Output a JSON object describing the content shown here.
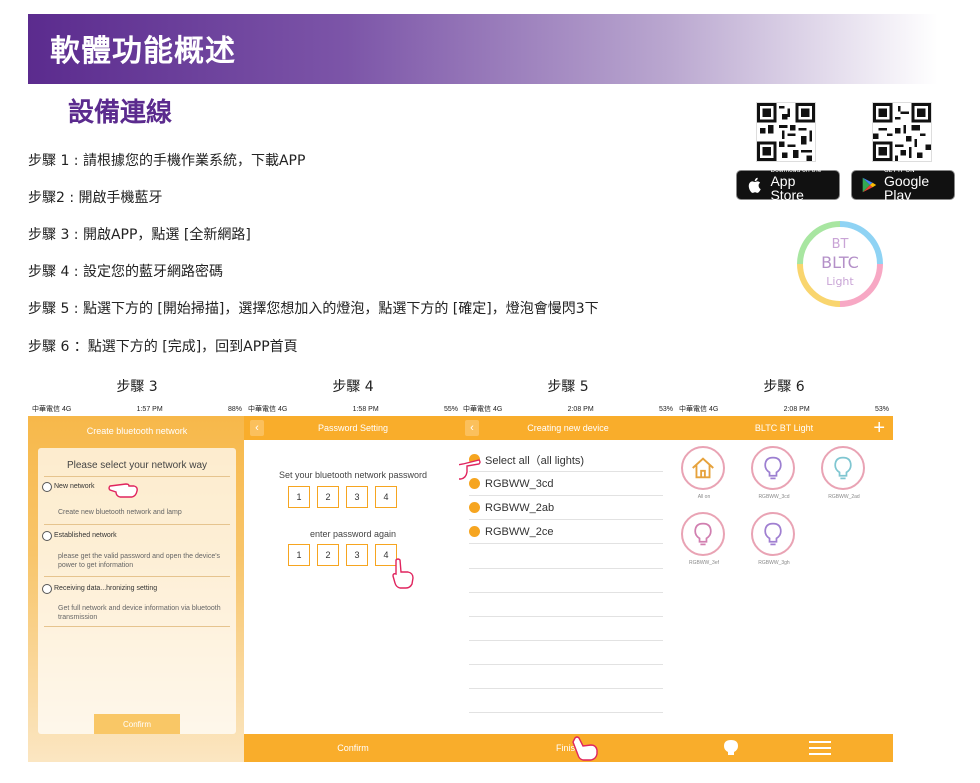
{
  "banner": {
    "title": "軟體功能概述"
  },
  "section": {
    "title": "設備連線"
  },
  "steps": [
    "步驟 1 : 請根據您的手機作業系統，下載APP",
    "步驟2 : 開啟手機藍牙",
    "步驟 3 : 開啟APP，點選 [全新網路]",
    "步驟 4 : 設定您的藍牙網路密碼",
    "步驟 5 : 點選下方的 [開始掃描]，選擇您想加入的燈泡，點選下方的 [確定]，燈泡會慢閃3下",
    "步驟 6 ：點選下方的 [完成]，回到APP首頁"
  ],
  "stores": {
    "appstore_small": "Download on the",
    "appstore_big": "App Store",
    "googleplay_small": "GET IT ON",
    "googleplay_big": "Google Play"
  },
  "logo": {
    "line1": "BT",
    "line2": "BLTC",
    "line3": "Light"
  },
  "phones": {
    "labels": [
      "步驟 3",
      "步驟 4",
      "步驟 5",
      "步驟 6"
    ],
    "p1": {
      "status_left": "中華電信 4G",
      "status_time": "1:57 PM",
      "status_right": "88%",
      "title": "Create bluetooth network",
      "heading": "Please select your network way",
      "opt1_label": "New network",
      "opt1_desc": "Create new bluetooth network and lamp",
      "opt2_label": "Established network",
      "opt2_desc": "please get the valid password and open the device's power to get information",
      "opt3_label": "Receiving data...hronizing setting",
      "opt3_desc": "Get full network and device information via bluetooth transmission",
      "button": "Confirm"
    },
    "p2": {
      "status_left": "中華電信 4G",
      "status_time": "1:58 PM",
      "status_right": "55%",
      "title": "Password Setting",
      "label1": "Set your bluetooth network password",
      "label2": "enter password again",
      "digits": [
        "1",
        "2",
        "3",
        "4"
      ],
      "button": "Confirm"
    },
    "p3": {
      "status_left": "中華電信 4G",
      "status_time": "2:08 PM",
      "status_right": "53%",
      "title": "Creating new device",
      "devices": [
        "Select all（all lights)",
        "RGBWW_3cd",
        "RGBWW_2ab",
        "RGBWW_2ce"
      ],
      "button": "Finish"
    },
    "p4": {
      "status_left": "中華電信 4G",
      "status_time": "2:08 PM",
      "status_right": "53%",
      "title": "BLTC BT Light",
      "plus": "+",
      "tiles": [
        "All on",
        "RGBWW_3cd",
        "RGBWW_2ad",
        "RGBWW_3ef",
        "RGBWW_3gh"
      ]
    }
  },
  "colors": {
    "accent": "#f9ad2b",
    "purple": "#5b2b8e"
  }
}
